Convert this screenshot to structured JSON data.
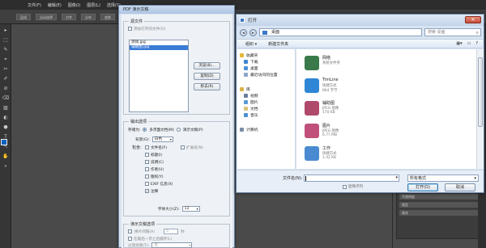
{
  "ps": {
    "menu": [
      "文件(F)",
      "编辑(E)",
      "图像(I)",
      "图层(L)",
      "选择(S)"
    ],
    "options": [
      "层组",
      "自动选择",
      "对齐",
      "分布",
      "变换",
      "变形"
    ],
    "tool_glyphs": [
      "▸",
      "⬚",
      "✎",
      "⌖",
      "✂",
      "✐",
      "⊘",
      "⌫",
      "▨",
      "◐",
      "⬣",
      "T",
      "↖",
      "✋",
      "⌕"
    ],
    "layers": [
      "正常",
      "不透明度",
      "锁定",
      "填充"
    ]
  },
  "pdf": {
    "title": "PDF 演示文稿",
    "src_group": "源文件",
    "add_open": "添加打开的文件(O)",
    "files": [
      "测试.jpg",
      "辅助图.jpg"
    ],
    "browse": "浏览(B)...",
    "duplicate": "复制(D)",
    "remove": "移去(R)",
    "out_group": "输出选项",
    "save_as": "存储为:",
    "multi_page": "多页面文档(M)",
    "slideshow": "演示文稿(P)",
    "bg_label": "背景(G):",
    "bg_value": "白色",
    "include_label": "包含:",
    "opts_left": [
      "文件名(F)",
      "标题(I)",
      "说明(C)",
      "作者(U)",
      "版权(Y)",
      "EXIF 信息(X)",
      "注释"
    ],
    "opts_right": [
      "扩展名(N)"
    ],
    "font_size_label": "字体大小(Z):",
    "font_size_value": "12",
    "slide_group": "演示文稿选项",
    "advance": "换片间隔(A)",
    "advance_value": "5",
    "seconds": "秒",
    "loop": "在最后一页之后循环(L)",
    "transition_label": "过渡效果(T):",
    "transition_value": "无"
  },
  "open": {
    "title": "打开",
    "close": "✕",
    "address": "桌面",
    "search_placeholder": "搜索 桌面",
    "organize": "组织 ▾",
    "new_folder": "新建文件夹",
    "nav": [
      {
        "label": "收藏夹",
        "hdr": true,
        "color": "#e5b837"
      },
      {
        "label": "下载",
        "hdr": false,
        "color": "#3d86d2"
      },
      {
        "label": "桌面",
        "hdr": false,
        "color": "#4a8fd9"
      },
      {
        "label": "最近访问的位置",
        "hdr": false,
        "color": "#8aa6c8"
      },
      {
        "label": "库",
        "hdr": true,
        "color": "#d9b24a"
      },
      {
        "label": "视频",
        "hdr": false,
        "color": "#6a7fa0"
      },
      {
        "label": "图片",
        "hdr": false,
        "color": "#5a9ad5"
      },
      {
        "label": "文档",
        "hdr": false,
        "color": "#d8c27a"
      },
      {
        "label": "音乐",
        "hdr": false,
        "color": "#4b8ed3"
      },
      {
        "label": "计算机",
        "hdr": true,
        "color": "#7a8ea8"
      }
    ],
    "files": [
      {
        "name": "网络",
        "t1": "系统文件夹",
        "t2": "",
        "color": "#3a7a4a"
      },
      {
        "name": "TimLine",
        "t1": "快捷方式",
        "t2": "804 字节",
        "color": "#2f86d6"
      },
      {
        "name": "辅助图",
        "t1": "JPEG 图像",
        "t2": "170 KB",
        "color": "#b04a6a"
      },
      {
        "name": "图片",
        "t1": "JPEG 图像",
        "t2": "6.77 MB",
        "color": "#c0507a"
      },
      {
        "name": "工作",
        "t1": "快捷方式",
        "t2": "1.42 KB",
        "color": "#4a8ad0"
      }
    ],
    "fname_label": "文件名(N):",
    "ftype": "所有格式",
    "seq_label": "图像序列",
    "open_btn": "打开(O)",
    "cancel_btn": "取消"
  }
}
